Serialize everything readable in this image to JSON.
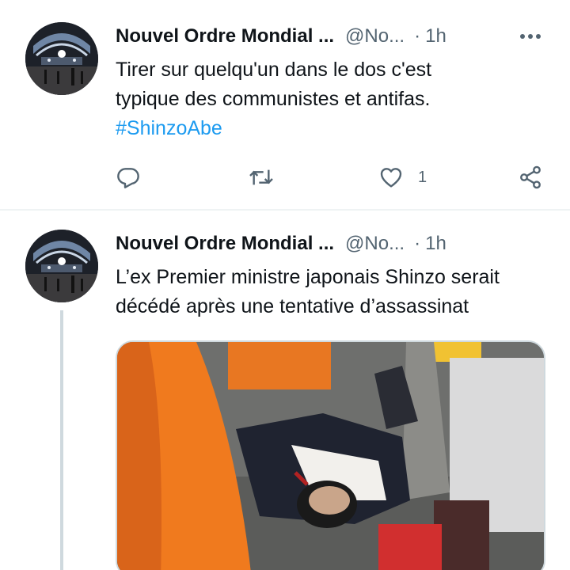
{
  "tweets": [
    {
      "author_name": "Nouvel Ordre Mondial ...",
      "handle": "@No...",
      "separator": "·",
      "time": "1h",
      "text_line1": "Tirer sur quelqu'un dans le dos c'est",
      "text_line2": "typique des communistes et antifas.",
      "hashtag": "#ShinzoAbe",
      "like_count": "1"
    },
    {
      "author_name": "Nouvel Ordre Mondial ...",
      "handle": "@No...",
      "separator": "·",
      "time": "1h",
      "text_line1": "L’ex Premier ministre japonais Shinzo serait",
      "text_line2": "décédé après une tentative d’assassinat"
    }
  ],
  "icons": {
    "reply": "reply-icon",
    "retweet": "retweet-icon",
    "like": "heart-icon",
    "share": "share-icon",
    "more": "more-icon"
  },
  "colors": {
    "text": "#0f1419",
    "secondary": "#536471",
    "link": "#1d9bf0",
    "divider": "#eff3f4",
    "thread_line": "#cfd9de"
  }
}
